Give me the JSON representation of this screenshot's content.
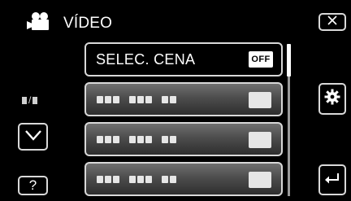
{
  "header": {
    "title": "VÍDEO",
    "icon": "movie-camera-icon"
  },
  "menu": {
    "items": [
      {
        "label": "SELEC. CENA",
        "value": "OFF",
        "enabled": true
      },
      {
        "label": "",
        "value": "",
        "enabled": false
      },
      {
        "label": "",
        "value": "",
        "enabled": false
      },
      {
        "label": "",
        "value": "",
        "enabled": false
      }
    ]
  },
  "page_indicator": {
    "separator": "/"
  },
  "buttons": {
    "close_icon": "close-x-icon",
    "settings_icon": "gear-icon",
    "down_icon": "chevron-down-icon",
    "help_label": "?",
    "back_icon": "return-arrow-icon"
  },
  "colors": {
    "background": "#000000",
    "button_border": "#d9d9d9",
    "disabled_row_top": "#6f6f6f",
    "disabled_row_bottom": "#2e2e2e",
    "text": "#ffffff"
  }
}
